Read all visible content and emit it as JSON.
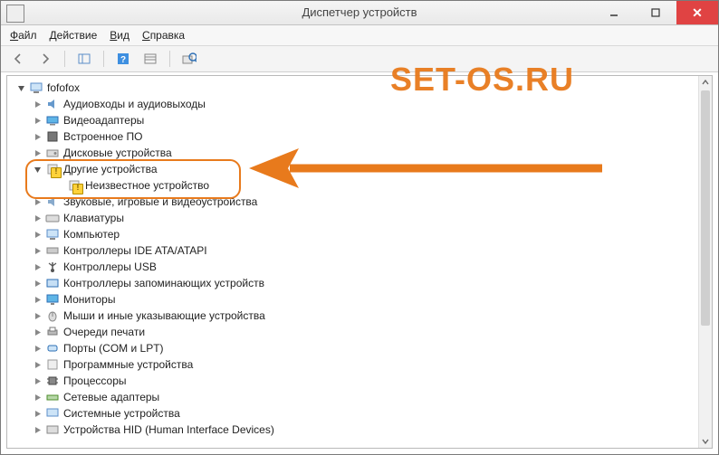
{
  "window": {
    "title": "Диспетчер устройств"
  },
  "menu": {
    "file": "Файл",
    "action": "Действие",
    "view": "Вид",
    "help": "Справка"
  },
  "root": {
    "label": "fofofox"
  },
  "nodes": {
    "audio": "Аудиовходы и аудиовыходы",
    "video_adapters": "Видеоадаптеры",
    "firmware": "Встроенное ПО",
    "disk_drives": "Дисковые устройства",
    "other_devices": "Другие устройства",
    "unknown_device": "Неизвестное устройство",
    "sound_game_video": "Звуковые, игровые и видеоустройства",
    "keyboards": "Клавиатуры",
    "computer": "Компьютер",
    "ide_ata": "Контроллеры IDE ATA/ATAPI",
    "usb_ctrl": "Контроллеры USB",
    "storage_ctrl": "Контроллеры запоминающих устройств",
    "monitors": "Мониторы",
    "mice": "Мыши и иные указывающие устройства",
    "print_queues": "Очереди печати",
    "ports": "Порты (COM и LPT)",
    "software_devices": "Программные устройства",
    "processors": "Процессоры",
    "network_adapters": "Сетевые адаптеры",
    "system_devices": "Системные устройства",
    "hid": "Устройства HID (Human Interface Devices)"
  },
  "watermark": "SET-OS.RU",
  "annotation_color": "#E87A1C"
}
